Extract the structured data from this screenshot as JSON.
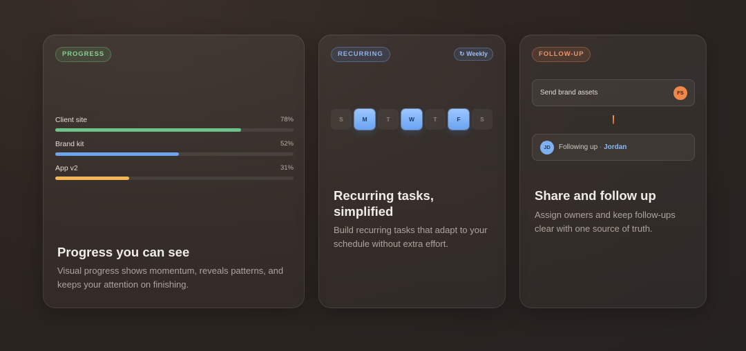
{
  "progress_card": {
    "tag": "PROGRESS",
    "items": [
      {
        "label": "Client site",
        "value": "78%",
        "fraction": 0.78,
        "color": "#6cc48a"
      },
      {
        "label": "Brand kit",
        "value": "52%",
        "fraction": 0.52,
        "color": "#6ea3ee"
      },
      {
        "label": "App v2",
        "value": "31%",
        "fraction": 0.31,
        "color": "#f2b657"
      }
    ],
    "title": "Progress you can see",
    "description": "Visual progress shows momentum, reveals patterns, and keeps your attention on finishing."
  },
  "recurring_card": {
    "tag": "RECURRING",
    "frequency_badge": "Weekly",
    "frequency_icon": "repeat-icon",
    "days": [
      {
        "letter": "S",
        "active": false
      },
      {
        "letter": "M",
        "active": true
      },
      {
        "letter": "T",
        "active": false
      },
      {
        "letter": "W",
        "active": true
      },
      {
        "letter": "T",
        "active": false
      },
      {
        "letter": "F",
        "active": true
      },
      {
        "letter": "S",
        "active": false
      }
    ],
    "title": "Recurring tasks, simplified",
    "description": "Build recurring tasks that adapt to your schedule without extra effort."
  },
  "followup_card": {
    "tag": "FOLLOW-UP",
    "task": {
      "label": "Send brand assets",
      "owner_initials": "FS"
    },
    "follow": {
      "initials": "JD",
      "prefix": "Following up",
      "separator": "·",
      "name": "Jordan"
    },
    "title": "Share and follow up",
    "description": "Assign owners and keep follow-ups clear with one source of truth."
  },
  "colors": {
    "progress_accent": "#86cf93",
    "recurring_accent": "#8eb2e6",
    "followup_accent": "#e9956a"
  }
}
